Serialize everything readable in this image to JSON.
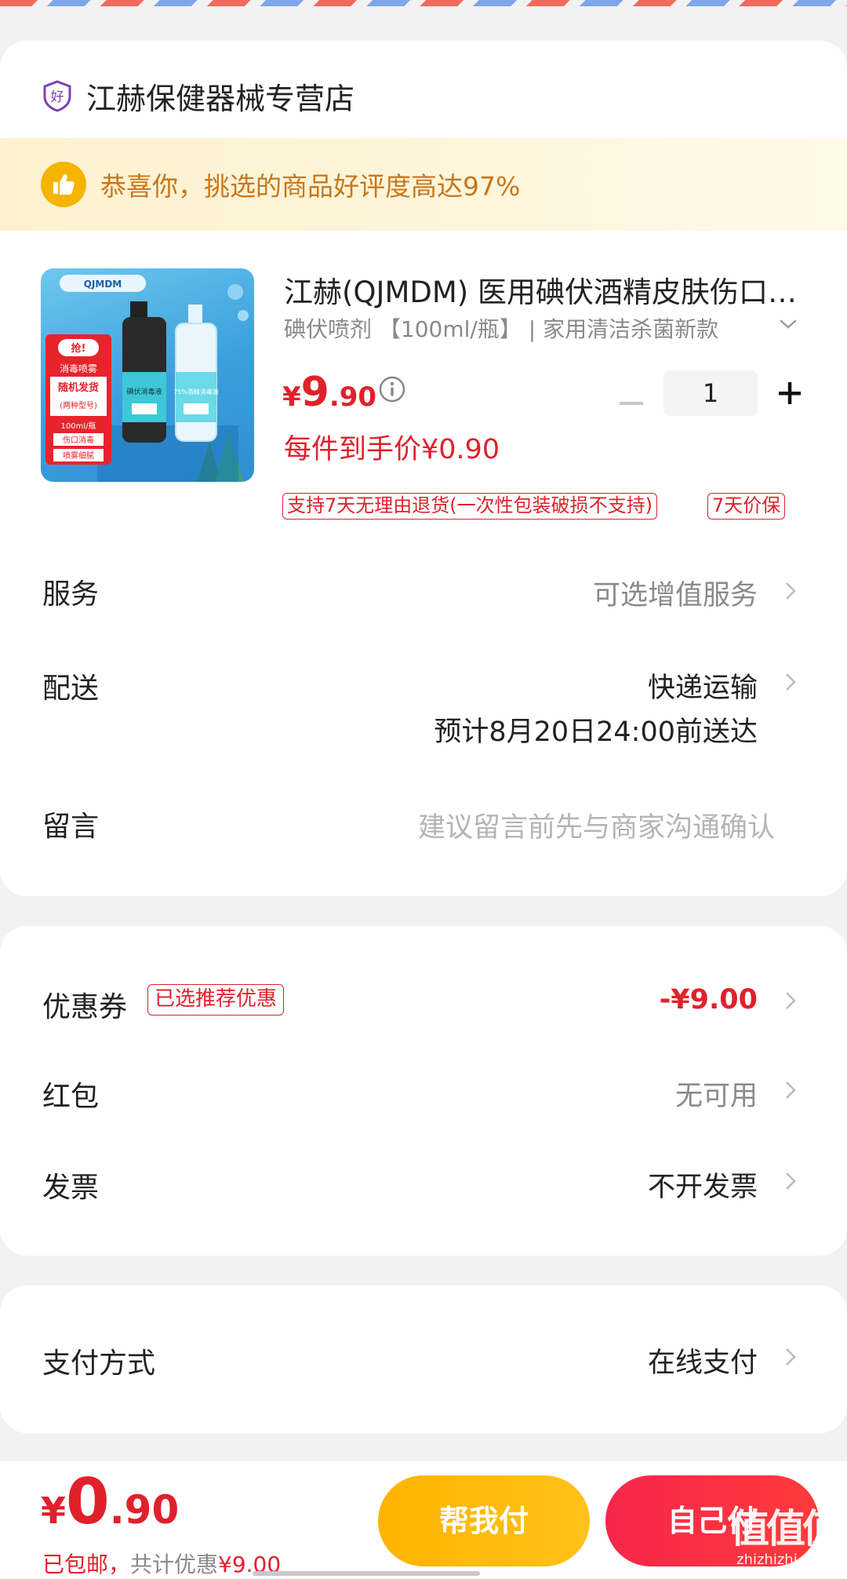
{
  "shop": {
    "icon": "shield-badge-icon",
    "icon_char": "好",
    "name": "江赫保健器械专营店"
  },
  "praise": {
    "icon": "thumbs-up-icon",
    "text": "恭喜你，挑选的商品好评度高达97%"
  },
  "product": {
    "image": {
      "brand": "QJMDM",
      "badge": "抢!",
      "line1": "消毒喷雾",
      "line2": "随机发货",
      "line3": "(两种型号)",
      "line4": "100ml/瓶",
      "line5": "伤口消毒",
      "line6": "喷雾细腻",
      "bottle1_label": "碘伏消毒液",
      "bottle2_label": "75%酒精消毒液"
    },
    "title": "江赫(QJMDM) 医用碘伏酒精皮肤伤口消毒",
    "spec": "碘伏喷剂 【100ml/瓶】 | 家用清洁杀菌新款",
    "price_symbol": "¥",
    "price_int": "9",
    "price_dec": ".90",
    "quantity": "1",
    "unit_price": "每件到手价¥0.90",
    "tags": [
      "支持7天无理由退货(一次性包装破损不支持)",
      "7天价保"
    ]
  },
  "rows": {
    "service": {
      "label": "服务",
      "value": "可选增值服务"
    },
    "delivery": {
      "label": "配送",
      "value": "快递运输",
      "eta": "预计8月20日24:00前送达"
    },
    "message": {
      "label": "留言",
      "placeholder": "建议留言前先与商家沟通确认"
    },
    "coupon": {
      "label": "优惠券",
      "tag": "已选推荐优惠",
      "value": "-¥9.00"
    },
    "redpacket": {
      "label": "红包",
      "value": "无可用"
    },
    "invoice": {
      "label": "发票",
      "value": "不开发票"
    },
    "payment": {
      "label": "支付方式",
      "value": "在线支付"
    }
  },
  "footer": {
    "total_symbol": "¥",
    "total_int": "0",
    "total_dec": ".90",
    "shipping": "已包邮，",
    "discount_prefix": "共计优惠",
    "discount": "¥9.00",
    "help_pay": "帮我付",
    "self_pay": "自己付",
    "watermark": "值值值",
    "watermark_url": "zhizhizhi.com"
  },
  "colors": {
    "accent": "#e0212b",
    "help_button": "#ffb300",
    "self_button": "#f6264a",
    "praise_text": "#c9761b"
  }
}
